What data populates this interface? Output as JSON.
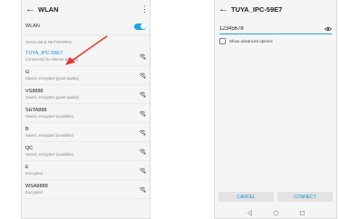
{
  "left_screen": {
    "title": "WLAN",
    "back_icon": "back-arrow-icon",
    "menu_icon": "more-vert-icon",
    "wlan_toggle": {
      "label": "WLAN",
      "enabled": true
    },
    "section_header": "AVAILABLE NETWORKS",
    "networks": [
      {
        "name": "TUYA_IPC-59E7",
        "status": "Connected (no internet access)",
        "active": true
      },
      {
        "name": "G",
        "status": "Saved, encrypted (good quality)",
        "active": false
      },
      {
        "name": "VS8888",
        "status": "Saved, encrypted (good quality)",
        "active": false
      },
      {
        "name": "SHTA888",
        "status": "Saved, encrypted (available)",
        "active": false
      },
      {
        "name": "B",
        "status": "Saved, encrypted (available)",
        "active": false
      },
      {
        "name": "QC",
        "status": "Saved, encrypted (available)",
        "active": false
      },
      {
        "name": "E",
        "status": "Encrypted",
        "active": false
      },
      {
        "name": "WSA8888",
        "status": "Encrypted",
        "active": false
      }
    ],
    "accent_color": "#1aa3e8",
    "annotation_color": "#e53935"
  },
  "right_screen": {
    "title": "TUYA_IPC-59E7",
    "back_icon": "back-arrow-icon",
    "password_value": "12345678",
    "show_password_icon": "eye-icon",
    "advanced_options_label": "Show advanced options",
    "cancel_label": "CANCEL",
    "connect_label": "CONNECT",
    "nav_icons": [
      "back-triangle-icon",
      "home-circle-icon",
      "recents-square-icon"
    ]
  }
}
